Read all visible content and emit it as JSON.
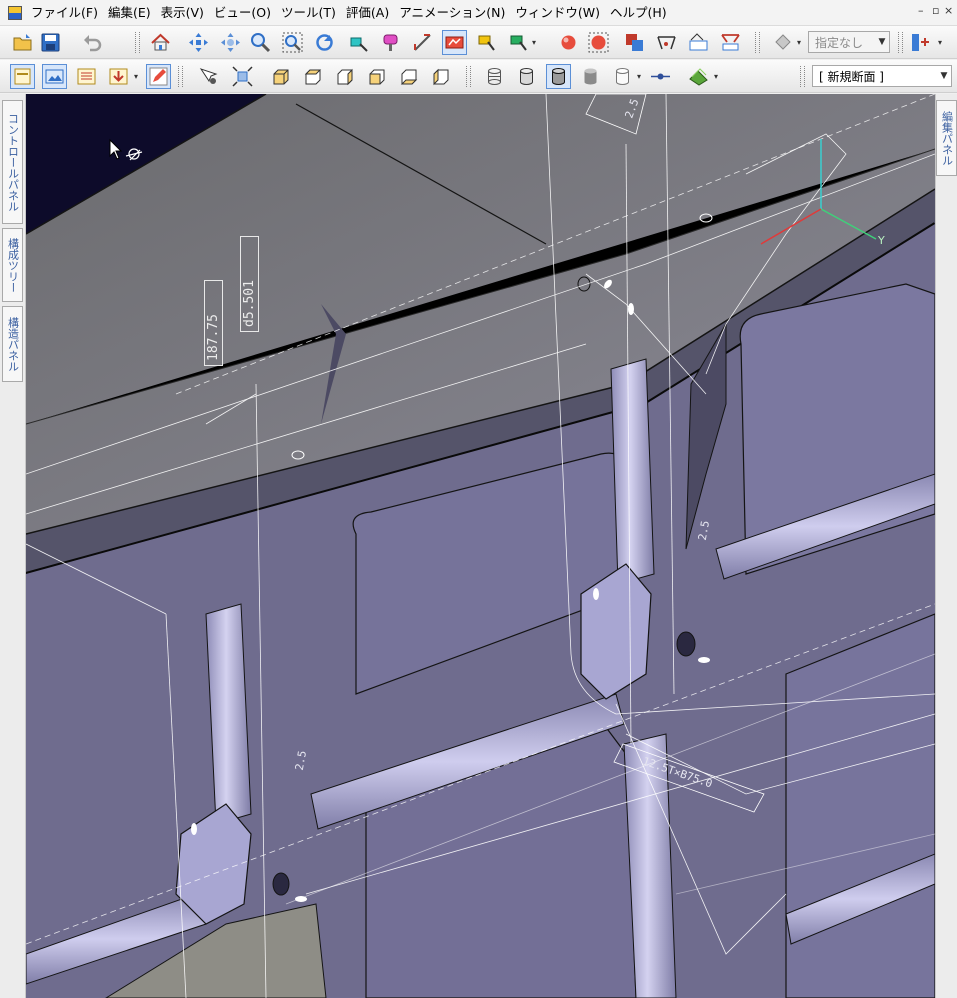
{
  "menubar": {
    "items": [
      "ファイル(F)",
      "編集(E)",
      "表示(V)",
      "ビュー(O)",
      "ツール(T)",
      "評価(A)",
      "アニメーション(N)",
      "ウィンドウ(W)",
      "ヘルプ(H)"
    ],
    "controls": {
      "minimize": "–",
      "restore": "▫",
      "close": "×"
    }
  },
  "toolbar1": {
    "target_combo": "指定なし"
  },
  "toolbar2": {
    "section_combo": "[ 新規断面 ]"
  },
  "side_tabs": [
    "コントロールパネル",
    "構成ツリー",
    "構造パネル"
  ],
  "right_tab": "編集パネル",
  "viewport": {
    "dimensions": [
      "187.75",
      "d5.501"
    ],
    "notes": [
      "2.5",
      "2.5",
      "2.5",
      "12.5T×B75.0"
    ],
    "axis_label": "Y"
  },
  "colors": {
    "background_dark": "#0d0b2a",
    "part_face": "#6f6c8e",
    "part_light": "#8a87a8",
    "rib": "#b6b4d8",
    "edge": "#141414",
    "wire": "#ffffff"
  }
}
